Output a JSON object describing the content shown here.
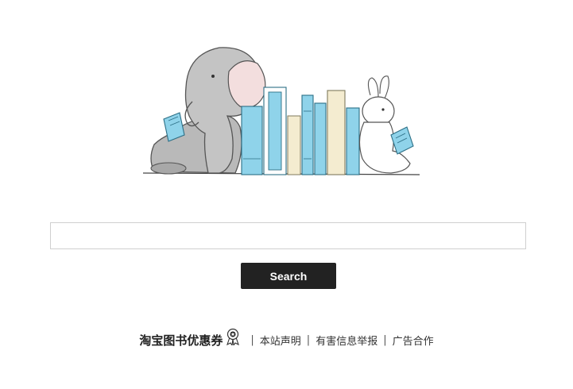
{
  "search": {
    "value": "",
    "placeholder": "",
    "button_label": "Search"
  },
  "footer": {
    "brand": "淘宝图书优惠券",
    "separator": "|",
    "links": [
      "本站声明",
      "有害信息举报",
      "广告合作"
    ]
  },
  "icons": {
    "hero": "elephant-rabbit-reading-books-illustration",
    "badge": "award-ribbon-icon"
  },
  "colors": {
    "button_bg": "#222222",
    "button_text": "#ffffff",
    "input_border": "#cfcfcf",
    "book_blue": "#8fd3ea",
    "book_cream": "#f4ecd0"
  }
}
